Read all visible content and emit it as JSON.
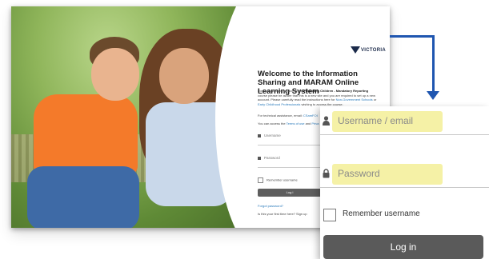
{
  "background_page": {
    "logo_text": "VICTORIA",
    "title": "Welcome to the Information Sharing and MARAM Online Learning System",
    "intro_text_1": "For users wishing to access the ",
    "intro_bold": "Protecting Children - Mandatory Reporting",
    "intro_text_2": " course please be aware that this is a new site and you are required to set up a new account. Please carefully read the instructions here for ",
    "intro_link_1": "Non-Government Schools",
    "intro_text_3": " or ",
    "intro_link_2": "Early Childhood Professionals",
    "intro_text_4": " wishing to access the course.",
    "assistance_text": "For technical assistance, email: ",
    "assistance_email": "CSamFOI",
    "terms_text": "You can access the ",
    "terms_link": "Terms of use",
    "terms_and": " and ",
    "privacy_link": "Priva",
    "username_placeholder": "Username",
    "password_placeholder": "Password",
    "remember_label": "Remember username",
    "login_label": "Log i",
    "forgot_label": "Forgot password?",
    "first_time_label": "Is this your first time here? Sign up"
  },
  "zoom_panel": {
    "username_placeholder": "Username / email",
    "password_placeholder": "Password",
    "remember_label": "Remember username",
    "login_label": "Log in"
  },
  "colors": {
    "arrow": "#1f56b0",
    "highlight": "#f5f1a6",
    "login_button": "#5a5a5a"
  },
  "icons": [
    "lock-icon",
    "checkbox-icon",
    "arrow-connector-icon"
  ]
}
